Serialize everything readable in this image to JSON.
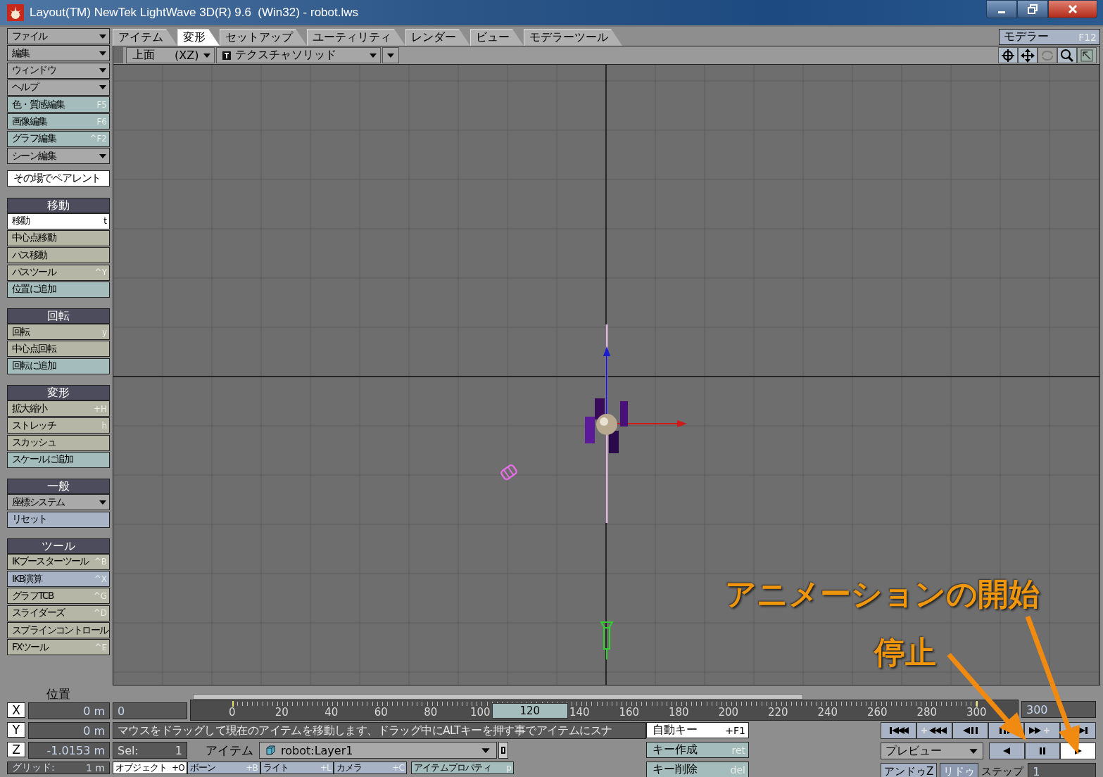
{
  "window": {
    "title": "Layout(TM) NewTek LightWave 3D(R) 9.6  (Win32) - robot.lws"
  },
  "tabs": [
    {
      "label": "アイテム",
      "selected": false
    },
    {
      "label": "変形",
      "selected": true
    },
    {
      "label": "セットアップ",
      "selected": false
    },
    {
      "label": "ユーティリティ",
      "selected": false
    },
    {
      "label": "レンダー",
      "selected": false
    },
    {
      "label": "ビュー",
      "selected": false
    },
    {
      "label": "モデラーツール",
      "selected": false
    }
  ],
  "modeler_button": {
    "label": "モデラー",
    "shortcut": "F12"
  },
  "view_toolbar": {
    "view": "上面",
    "axes": "(XZ)",
    "render_mode": "テクスチャソリッド"
  },
  "sidebar": {
    "menus": [
      {
        "label": "ファイル",
        "kind": "dropdown"
      },
      {
        "label": "編集",
        "kind": "dropdown"
      },
      {
        "label": "ウィンドウ",
        "kind": "dropdown"
      },
      {
        "label": "ヘルプ",
        "kind": "dropdown"
      },
      {
        "label": "色・質感編集",
        "kind": "command",
        "shortcut": "F5"
      },
      {
        "label": "画像編集",
        "kind": "command",
        "shortcut": "F6"
      },
      {
        "label": "グラフ編集",
        "kind": "command",
        "shortcut": "^F2"
      },
      {
        "label": "シーン編集",
        "kind": "dropdown"
      }
    ],
    "parent_toggle": {
      "label": "その場でペアレント",
      "on": true
    },
    "sections": [
      {
        "title": "移動",
        "items": [
          {
            "label": "移動",
            "shortcut": "t",
            "kind": "tool",
            "selected": true
          },
          {
            "label": "中心点移動",
            "kind": "tool",
            "selected": false
          },
          {
            "label": "パス移動",
            "kind": "tool",
            "selected": false
          },
          {
            "label": "パスツール",
            "shortcut": "^Y",
            "kind": "tool",
            "selected": false
          },
          {
            "label": "位置に追加",
            "kind": "command",
            "selected": false
          }
        ]
      },
      {
        "title": "回転",
        "items": [
          {
            "label": "回転",
            "shortcut": "y",
            "kind": "tool",
            "selected": false
          },
          {
            "label": "中心点回転",
            "kind": "tool",
            "selected": false
          },
          {
            "label": "回転に追加",
            "kind": "command",
            "selected": false
          }
        ]
      },
      {
        "title": "変形",
        "items": [
          {
            "label": "拡大縮小",
            "shortcut": "+H",
            "kind": "tool",
            "selected": false
          },
          {
            "label": "ストレッチ",
            "shortcut": "h",
            "kind": "tool",
            "selected": false
          },
          {
            "label": "スカッシュ",
            "kind": "tool",
            "selected": false
          },
          {
            "label": "スケールに追加",
            "kind": "command",
            "selected": false
          }
        ]
      },
      {
        "title": "一般",
        "items": [
          {
            "label": "座標システム",
            "kind": "dropdown",
            "selected": false
          },
          {
            "label": "リセット",
            "kind": "action",
            "selected": false
          }
        ]
      },
      {
        "title": "ツール",
        "items": [
          {
            "label": "IKブースターツール",
            "shortcut": "^B",
            "kind": "tool",
            "selected": false
          },
          {
            "label": "IKB演算",
            "shortcut": "^X",
            "kind": "action",
            "selected": false
          },
          {
            "label": "グラフTCB",
            "shortcut": "^G",
            "kind": "tool",
            "selected": false
          },
          {
            "label": "スライダーズ",
            "shortcut": "^D",
            "kind": "tool",
            "selected": false
          },
          {
            "label": "スプラインコントロール",
            "kind": "tool",
            "selected": false
          },
          {
            "label": "FXツール",
            "shortcut": "^E",
            "kind": "tool",
            "selected": false
          }
        ]
      }
    ]
  },
  "position": {
    "title": "位置",
    "axes": [
      {
        "label": "X",
        "value": "0 m"
      },
      {
        "label": "Y",
        "value": "0 m"
      },
      {
        "label": "Z",
        "value": "-1.0153 m"
      }
    ],
    "grid_label": "グリッド:",
    "grid_value": "1 m"
  },
  "frame_field": "0",
  "selection": {
    "label": "Sel:",
    "value": "1"
  },
  "timeline": {
    "ticks": [
      {
        "kind": "tick",
        "label": "0"
      },
      {
        "kind": "tick",
        "label": "20"
      },
      {
        "kind": "tick",
        "label": "40"
      },
      {
        "kind": "tick",
        "label": "60"
      },
      {
        "kind": "tick",
        "label": "80"
      },
      {
        "kind": "tick",
        "label": "100"
      },
      {
        "kind": "thumb",
        "label": "120"
      },
      {
        "kind": "tick",
        "label": "140"
      },
      {
        "kind": "tick",
        "label": "160"
      },
      {
        "kind": "tick",
        "label": "180"
      },
      {
        "kind": "tick",
        "label": "200"
      },
      {
        "kind": "tick",
        "label": "220"
      },
      {
        "kind": "tick",
        "label": "240"
      },
      {
        "kind": "tick",
        "label": "260"
      },
      {
        "kind": "tick",
        "label": "280"
      },
      {
        "kind": "tick",
        "label": "300"
      }
    ],
    "end_frame": "300"
  },
  "status_message": "マウスをドラッグして現在のアイテムを移動します、ドラッグ中にALTキーを押す事でアイテムにスナ",
  "item_selector": {
    "label": "アイテム",
    "value": "robot:Layer1"
  },
  "item_types": [
    {
      "label": "オブジェクト",
      "shortcut": "+O",
      "selected": true
    },
    {
      "label": "ボーン",
      "shortcut": "+B",
      "selected": false
    },
    {
      "label": "ライト",
      "shortcut": "+L",
      "selected": false
    },
    {
      "label": "カメラ",
      "shortcut": "+C",
      "selected": false
    }
  ],
  "item_properties": {
    "label": "アイテムプロパティ",
    "shortcut": "p"
  },
  "key_buttons": [
    {
      "label": "自動キー",
      "shortcut": "+F1",
      "on": true
    },
    {
      "label": "キー作成",
      "shortcut": "ret",
      "on": false
    },
    {
      "label": "キー削除",
      "shortcut": "del",
      "on": false
    }
  ],
  "preview": {
    "label": "プレビュー"
  },
  "playback": [
    {
      "kind": "reverse",
      "selected": false
    },
    {
      "kind": "pause",
      "selected": false
    },
    {
      "kind": "play",
      "selected": true
    }
  ],
  "undo": {
    "label": "アンドゥZ",
    "disabled": false
  },
  "redo": {
    "label": "リドゥ",
    "disabled": true
  },
  "step": {
    "label": "ステップ",
    "value": "1"
  },
  "annotations": [
    {
      "text": "アニメーションの開始"
    },
    {
      "text": "停止"
    }
  ]
}
